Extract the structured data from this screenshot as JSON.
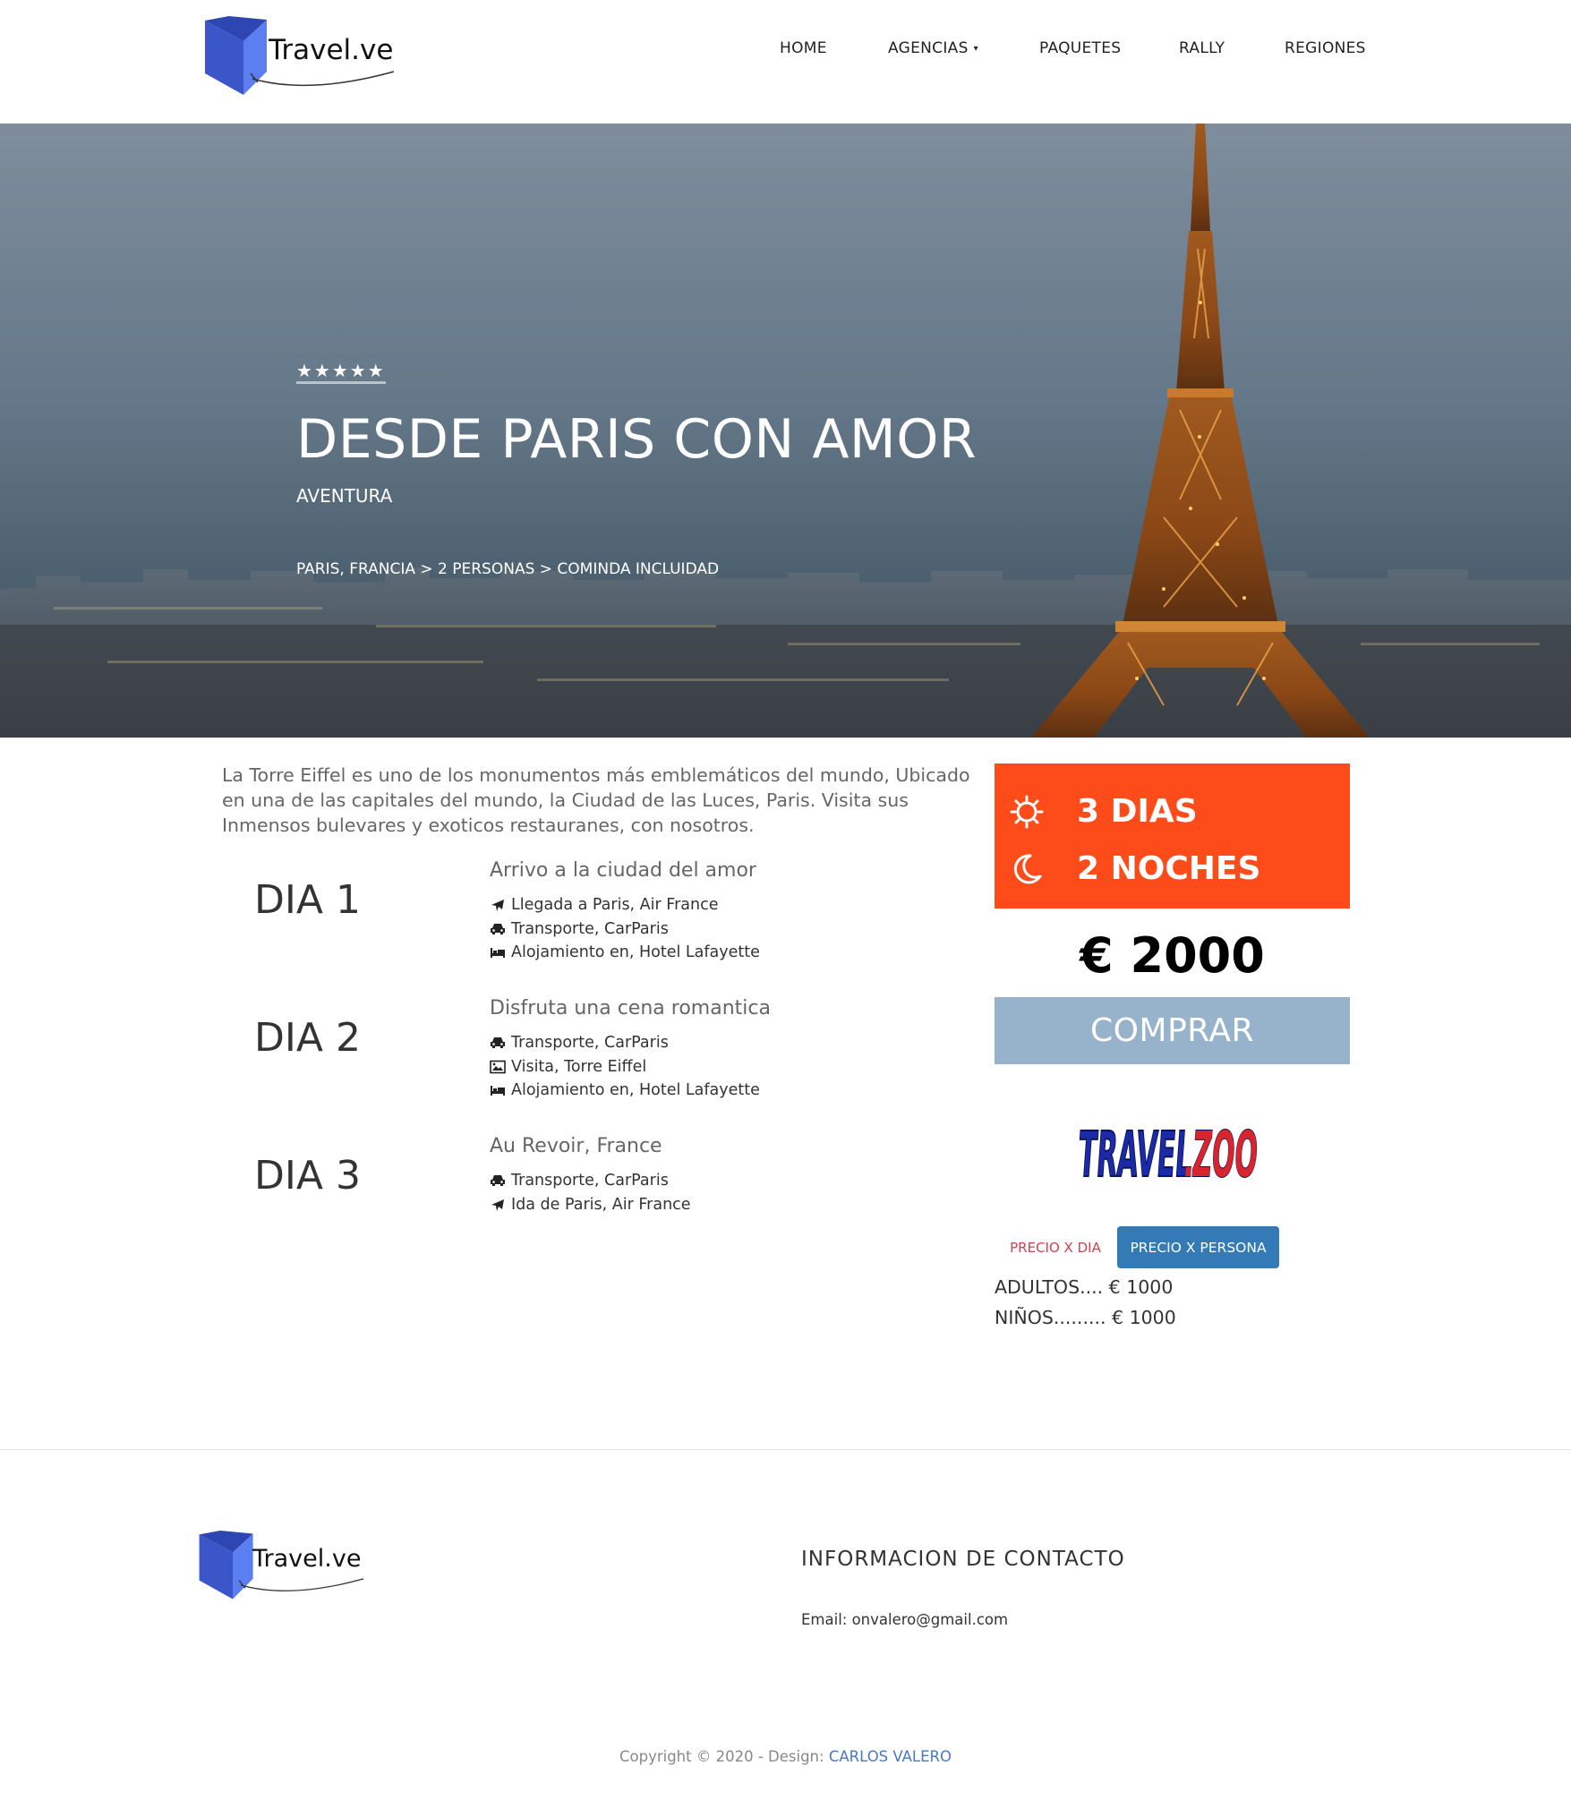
{
  "brand": {
    "name": "Travel.ve"
  },
  "nav": {
    "items": [
      {
        "label": "HOME"
      },
      {
        "label": "AGENCIAS",
        "caret": "▾"
      },
      {
        "label": "PAQUETES"
      },
      {
        "label": "RALLY"
      },
      {
        "label": "REGIONES"
      }
    ]
  },
  "hero": {
    "rating_stars": "★★★★★",
    "rating": 5,
    "title": "DESDE PARIS CON AMOR",
    "subtitle": "AVENTURA",
    "breadcrumb": "PARIS, FRANCIA > 2 PERSONAS > COMINDA INCLUIDAD"
  },
  "intro": "La Torre Eiffel es uno de los monumentos más emblemáticos del mundo, Ubicado en una de las capitales del mundo, la Ciudad de las Luces, Paris. Visita sus Inmensos bulevares y exoticos restauranes, con nosotros.",
  "itinerary": [
    {
      "day": "DIA 1",
      "title": "Arrivo a la ciudad del amor",
      "items": [
        {
          "icon": "plane-icon",
          "text": "Llegada a Paris, Air France"
        },
        {
          "icon": "car-icon",
          "text": "Transporte, CarParis"
        },
        {
          "icon": "bed-icon",
          "text": "Alojamiento en, Hotel Lafayette"
        }
      ]
    },
    {
      "day": "DIA 2",
      "title": "Disfruta una cena romantica",
      "items": [
        {
          "icon": "car-icon",
          "text": "Transporte, CarParis"
        },
        {
          "icon": "image-icon",
          "text": "Visita, Torre Eiffel"
        },
        {
          "icon": "bed-icon",
          "text": "Alojamiento en, Hotel Lafayette"
        }
      ]
    },
    {
      "day": "DIA 3",
      "title": "Au Revoir, France",
      "items": [
        {
          "icon": "car-icon",
          "text": "Transporte, CarParis"
        },
        {
          "icon": "plane-icon",
          "text": "Ida de Paris, Air France"
        }
      ]
    }
  ],
  "sidebar": {
    "days": "3 DIAS",
    "nights": "2 NOCHES",
    "day_icon": "sun-icon",
    "night_icon": "moon-icon",
    "price": "€ 2000",
    "buy_label": "COMPRAR",
    "partner_logo": "TRAVELZOO",
    "tabs": [
      {
        "label": "PRECIO X DIA",
        "active": false
      },
      {
        "label": "PRECIO X PERSONA",
        "active": true
      }
    ],
    "prices": [
      {
        "label": "ADULTOS.... € 1000"
      },
      {
        "label": "NIÑOS......... € 1000"
      }
    ],
    "colors": {
      "duration_bg": "#fd4b19",
      "buy_bg": "#97b2cb",
      "active_tab": "#337ab7",
      "inactive_tab_text": "#c9444f"
    }
  },
  "footer": {
    "contact_heading": "INFORMACION DE CONTACTO",
    "email_line": "Email: onvalero@gmail.com",
    "copyright_prefix": "Copyright © 2020 - Design: ",
    "designer": "CARLOS VALERO"
  }
}
